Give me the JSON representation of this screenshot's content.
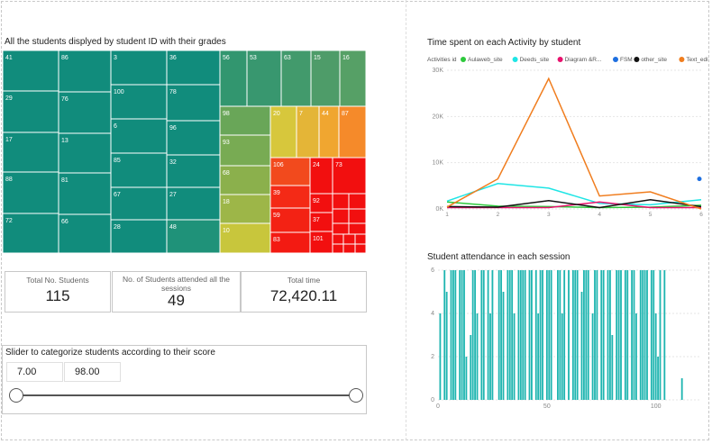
{
  "treemap": {
    "title": "All the students displyed by student ID with their grades",
    "cells": [
      {
        "label": "41",
        "color": "#118c7c"
      },
      {
        "label": "29",
        "color": "#118c7c"
      },
      {
        "label": "17",
        "color": "#118c7c"
      },
      {
        "label": "88",
        "color": "#118c7c"
      },
      {
        "label": "72",
        "color": "#118c7c"
      },
      {
        "label": "86",
        "color": "#118c7c"
      },
      {
        "label": "76",
        "color": "#118c7c"
      },
      {
        "label": "13",
        "color": "#118c7c"
      },
      {
        "label": "81",
        "color": "#118c7c"
      },
      {
        "label": "66",
        "color": "#118c7c"
      },
      {
        "label": "3",
        "color": "#118c7c"
      },
      {
        "label": "100",
        "color": "#118c7c"
      },
      {
        "label": "6",
        "color": "#118c7c"
      },
      {
        "label": "85",
        "color": "#118c7c"
      },
      {
        "label": "67",
        "color": "#118c7c"
      },
      {
        "label": "28",
        "color": "#118c7c"
      },
      {
        "label": "36",
        "color": "#118c7c"
      },
      {
        "label": "78",
        "color": "#118c7c"
      },
      {
        "label": "96",
        "color": "#118c7c"
      },
      {
        "label": "32",
        "color": "#118c7c"
      },
      {
        "label": "27",
        "color": "#118c7c"
      },
      {
        "label": "48",
        "color": "#1f9279"
      },
      {
        "label": "56",
        "color": "#32966f"
      },
      {
        "label": "53",
        "color": "#38976f"
      },
      {
        "label": "63",
        "color": "#429a6c"
      },
      {
        "label": "15",
        "color": "#4e9c69"
      },
      {
        "label": "16",
        "color": "#56a066"
      },
      {
        "label": "98",
        "color": "#69a658"
      },
      {
        "label": "93",
        "color": "#78ab53"
      },
      {
        "label": "68",
        "color": "#8bb04c"
      },
      {
        "label": "18",
        "color": "#9db648"
      },
      {
        "label": "10",
        "color": "#c8c63c"
      },
      {
        "label": "20",
        "color": "#d7c73c"
      },
      {
        "label": "7",
        "color": "#e4b537"
      },
      {
        "label": "44",
        "color": "#f0a630"
      },
      {
        "label": "87",
        "color": "#f58a2a"
      },
      {
        "label": "106",
        "color": "#f24a1d"
      },
      {
        "label": "39",
        "color": "#f42a16"
      },
      {
        "label": "59",
        "color": "#f32214"
      },
      {
        "label": "83",
        "color": "#f31a12"
      },
      {
        "label": "24",
        "color": "#f20f0f"
      },
      {
        "label": "73",
        "color": "#f20f0f"
      },
      {
        "label": "92",
        "color": "#f20f0f"
      },
      {
        "label": "37",
        "color": "#f20f0f"
      },
      {
        "label": "101",
        "color": "#f20f0f"
      },
      {
        "label": "",
        "color": "#f20f0f"
      },
      {
        "label": "",
        "color": "#f20f0f"
      },
      {
        "label": "",
        "color": "#f20f0f"
      },
      {
        "label": "",
        "color": "#f20f0f"
      },
      {
        "label": "",
        "color": "#f20f0f"
      },
      {
        "label": "",
        "color": "#f20f0f"
      },
      {
        "label": "",
        "color": "#f20f0f"
      },
      {
        "label": "",
        "color": "#f20f0f"
      },
      {
        "label": "",
        "color": "#f20f0f"
      },
      {
        "label": "",
        "color": "#f20f0f"
      },
      {
        "label": "",
        "color": "#f20f0f"
      },
      {
        "label": "",
        "color": "#f20f0f"
      },
      {
        "label": "",
        "color": "#f20f0f"
      }
    ]
  },
  "cards": [
    {
      "label": "Total No. Students",
      "value": "115"
    },
    {
      "label": "No. of Students attended all the sessions",
      "value": "49"
    },
    {
      "label": "Total time",
      "value": "72,420.11"
    }
  ],
  "slider": {
    "title": "Slider to categorize students according to their score",
    "min_value": "7.00",
    "max_value": "98.00",
    "range": [
      7,
      98
    ],
    "low": 7,
    "high": 98
  },
  "chart_data": [
    {
      "type": "line",
      "title": "Time spent on each Activity by student",
      "legend_title": "Activities id",
      "x": [
        1,
        2,
        3,
        4,
        5,
        6
      ],
      "ylim": [
        0,
        30000
      ],
      "yticks": [
        {
          "v": 0,
          "label": "0K"
        },
        {
          "v": 10000,
          "label": "10K"
        },
        {
          "v": 20000,
          "label": "20K"
        },
        {
          "v": 30000,
          "label": "30K"
        }
      ],
      "series": [
        {
          "name": "Aulaweb_site",
          "color": "#2dc93c",
          "values": [
            1500,
            600,
            500,
            300,
            400,
            800
          ]
        },
        {
          "name": "Deeds_site",
          "color": "#1fe5e5",
          "values": [
            1700,
            5500,
            4500,
            1200,
            900,
            2000
          ]
        },
        {
          "name": "Diagram &R...",
          "color": "#e8126d",
          "values": [
            300,
            300,
            300,
            1500,
            300,
            300
          ]
        },
        {
          "name": "FSM",
          "color": "#1e6fe0",
          "values": [
            null,
            null,
            null,
            null,
            null,
            6500
          ]
        },
        {
          "name": "other_site",
          "color": "#111111",
          "values": [
            500,
            400,
            1800,
            300,
            2000,
            500
          ]
        },
        {
          "name": "Text_editor...",
          "color": "#f07d1e",
          "values": [
            400,
            6500,
            28200,
            2800,
            3700,
            0
          ]
        }
      ]
    },
    {
      "type": "bar",
      "title": "Student attendance in each session",
      "ylim": [
        0,
        6
      ],
      "yticks": [
        0,
        2,
        4,
        6
      ],
      "xticks": [
        0,
        50,
        100
      ],
      "xlim": [
        0,
        120
      ],
      "color": "#1eb5b0",
      "values": [
        4,
        0,
        6,
        5,
        0,
        6,
        6,
        6,
        0,
        6,
        6,
        6,
        2,
        0,
        3,
        6,
        6,
        4,
        0,
        6,
        6,
        0,
        6,
        4,
        6,
        0,
        0,
        6,
        6,
        5,
        0,
        6,
        6,
        6,
        4,
        0,
        6,
        6,
        6,
        6,
        0,
        6,
        6,
        0,
        6,
        4,
        6,
        6,
        0,
        6,
        6,
        6,
        0,
        0,
        6,
        6,
        4,
        6,
        0,
        6,
        0,
        6,
        6,
        6,
        0,
        5,
        6,
        6,
        6,
        0,
        4,
        6,
        6,
        0,
        6,
        6,
        0,
        6,
        6,
        3,
        0,
        6,
        6,
        6,
        0,
        6,
        6,
        0,
        6,
        6,
        4,
        0,
        6,
        6,
        6,
        6,
        0,
        6,
        6,
        4,
        2,
        6,
        0,
        6,
        0,
        0,
        0,
        0,
        0,
        0,
        0,
        1
      ]
    }
  ]
}
